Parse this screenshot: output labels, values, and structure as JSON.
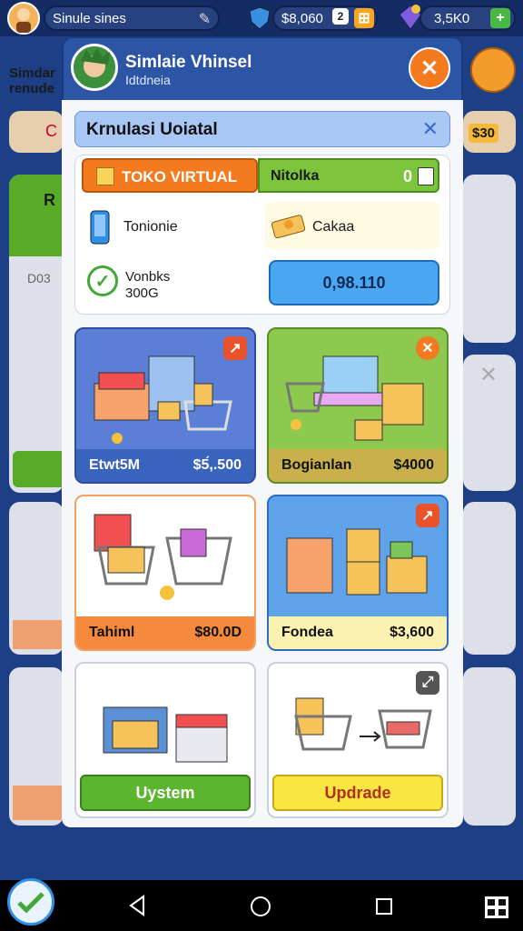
{
  "topbar": {
    "player_name": "Sinule sines",
    "coins": "$8,060",
    "gems": "3,5K0",
    "plus_label": "+"
  },
  "background": {
    "left_label": "Simdar\nrenude",
    "left_tag": "C",
    "right_amount": "$30",
    "left_code": "D03",
    "left_letter": "R"
  },
  "dialog": {
    "title": "Simlaie Vhinsel",
    "subtitle": "Idtdneia",
    "header_title": "Krnulasi Uoiatal",
    "store_title": "TOKO VIRTUAL",
    "store_tab_right": "Nitolka",
    "store_tab_right_value": "0",
    "info": {
      "item1": "Tonionie",
      "item2": "Cakaa",
      "item3_line1": "Vonbks",
      "item3_line2": "300G",
      "price_button": "0,98.110"
    },
    "cards": [
      {
        "name": "Etwt5M",
        "price": "$5́,.500",
        "tag": "↗"
      },
      {
        "name": "Bogianlan",
        "price": "$4000",
        "tag": "✕"
      },
      {
        "name": "Tahiml",
        "price": "$80.0D",
        "tag": ""
      },
      {
        "name": "Fondea",
        "price": "$3,600",
        "tag": "↗"
      },
      {
        "name": "",
        "price": "",
        "button": "Uystem"
      },
      {
        "name": "",
        "price": "",
        "button": "Updrade",
        "tag": "⤢"
      }
    ]
  },
  "colors": {
    "accent_orange": "#f47a1f",
    "accent_green": "#6fba2c",
    "accent_blue": "#2f8fe6",
    "dialog_blue": "#2c55a5"
  }
}
